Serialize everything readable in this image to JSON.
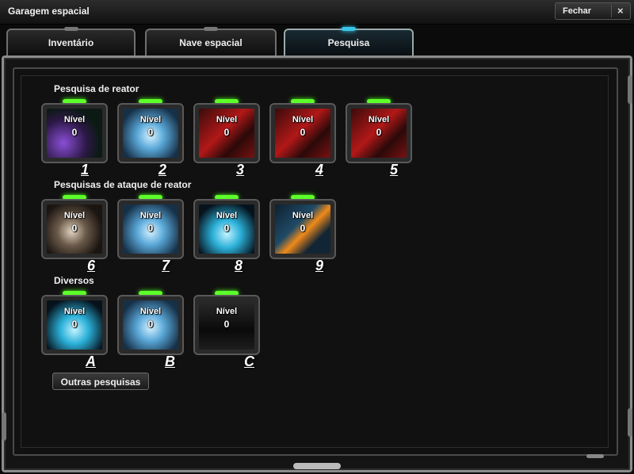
{
  "window": {
    "title": "Garagem espacial",
    "close_label": "Fechar",
    "close_symbol": "×"
  },
  "tabs": [
    {
      "label": "Inventário",
      "active": false
    },
    {
      "label": "Nave espacial",
      "active": false
    },
    {
      "label": "Pesquisa",
      "active": true
    }
  ],
  "sections": {
    "reactor": {
      "title": "Pesquisa de reator",
      "items": [
        {
          "level_label": "Nível",
          "level": "0",
          "tag": "1",
          "art": "purple"
        },
        {
          "level_label": "Nível",
          "level": "0",
          "tag": "2",
          "art": "blue"
        },
        {
          "level_label": "Nível",
          "level": "0",
          "tag": "3",
          "art": "red"
        },
        {
          "level_label": "Nível",
          "level": "0",
          "tag": "4",
          "art": "red"
        },
        {
          "level_label": "Nível",
          "level": "0",
          "tag": "5",
          "art": "red"
        }
      ]
    },
    "attack": {
      "title": "Pesquisas de ataque de reator",
      "items": [
        {
          "level_label": "Nível",
          "level": "0",
          "tag": "6",
          "art": "smoke"
        },
        {
          "level_label": "Nível",
          "level": "0",
          "tag": "7",
          "art": "blue"
        },
        {
          "level_label": "Nível",
          "level": "0",
          "tag": "8",
          "art": "cyan"
        },
        {
          "level_label": "Nível",
          "level": "0",
          "tag": "9",
          "art": "orange"
        }
      ]
    },
    "misc": {
      "title": "Diversos",
      "items": [
        {
          "level_label": "Nível",
          "level": "0",
          "tag": "A",
          "art": "cyan"
        },
        {
          "level_label": "Nível",
          "level": "0",
          "tag": "B",
          "art": "blue"
        },
        {
          "level_label": "Nível",
          "level": "0",
          "tag": "C",
          "art": "dark"
        }
      ]
    }
  },
  "other_button": "Outras pesquisas",
  "colors": {
    "led": "#5dff2a",
    "active_tab_accent": "#39c6e8"
  }
}
